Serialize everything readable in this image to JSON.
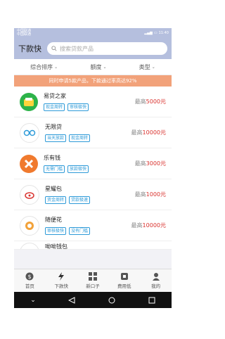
{
  "status": {
    "carrier1": "中国联通",
    "carrier2": "中国联通",
    "time": "11:40"
  },
  "header": {
    "title": "下款快",
    "search_placeholder": "搜索贷款产品"
  },
  "filters": [
    {
      "label": "综合排序"
    },
    {
      "label": "额度"
    },
    {
      "label": "类型"
    }
  ],
  "notice": "同时申请5款产品，下款通过率高达92%",
  "products": [
    {
      "name": "易贷之家",
      "tags": [
        "现金周转",
        "审核极快"
      ],
      "prefix": "最高",
      "amount": "5000元",
      "logo_color": "#2db34a",
      "icon": "wallet-icon"
    },
    {
      "name": "无限贷",
      "tags": [
        "当天放款",
        "现金周转"
      ],
      "prefix": "最高",
      "amount": "10000元",
      "logo_color": "#ffffff",
      "icon": "infinity-icon"
    },
    {
      "name": "乐有钱",
      "tags": [
        "无需门槛",
        "放款极快"
      ],
      "prefix": "最高",
      "amount": "3000元",
      "logo_color": "#f07a2e",
      "icon": "x-logo-icon"
    },
    {
      "name": "星耀包",
      "tags": [
        "资金周转",
        "贷款极速"
      ],
      "prefix": "最高",
      "amount": "1000元",
      "logo_color": "#ffffff",
      "icon": "bag-icon"
    },
    {
      "name": "随便花",
      "tags": [
        "审核极快",
        "没有门槛"
      ],
      "prefix": "最高",
      "amount": "10000元",
      "logo_color": "#ffffff",
      "icon": "coin-icon"
    },
    {
      "name": "呦呦钱包",
      "tags": [],
      "prefix": "",
      "amount": "",
      "logo_color": "#ffffff",
      "icon": "wallet-icon"
    }
  ],
  "tabbar": [
    {
      "label": "首页",
      "icon": "dollar-icon"
    },
    {
      "label": "下款快",
      "icon": "lightning-icon"
    },
    {
      "label": "新口子",
      "icon": "grid-icon"
    },
    {
      "label": "费用低",
      "icon": "tag-icon"
    },
    {
      "label": "我的",
      "icon": "person-icon"
    }
  ],
  "accent_color": "#2d9ad8",
  "amount_color": "#d9322e"
}
